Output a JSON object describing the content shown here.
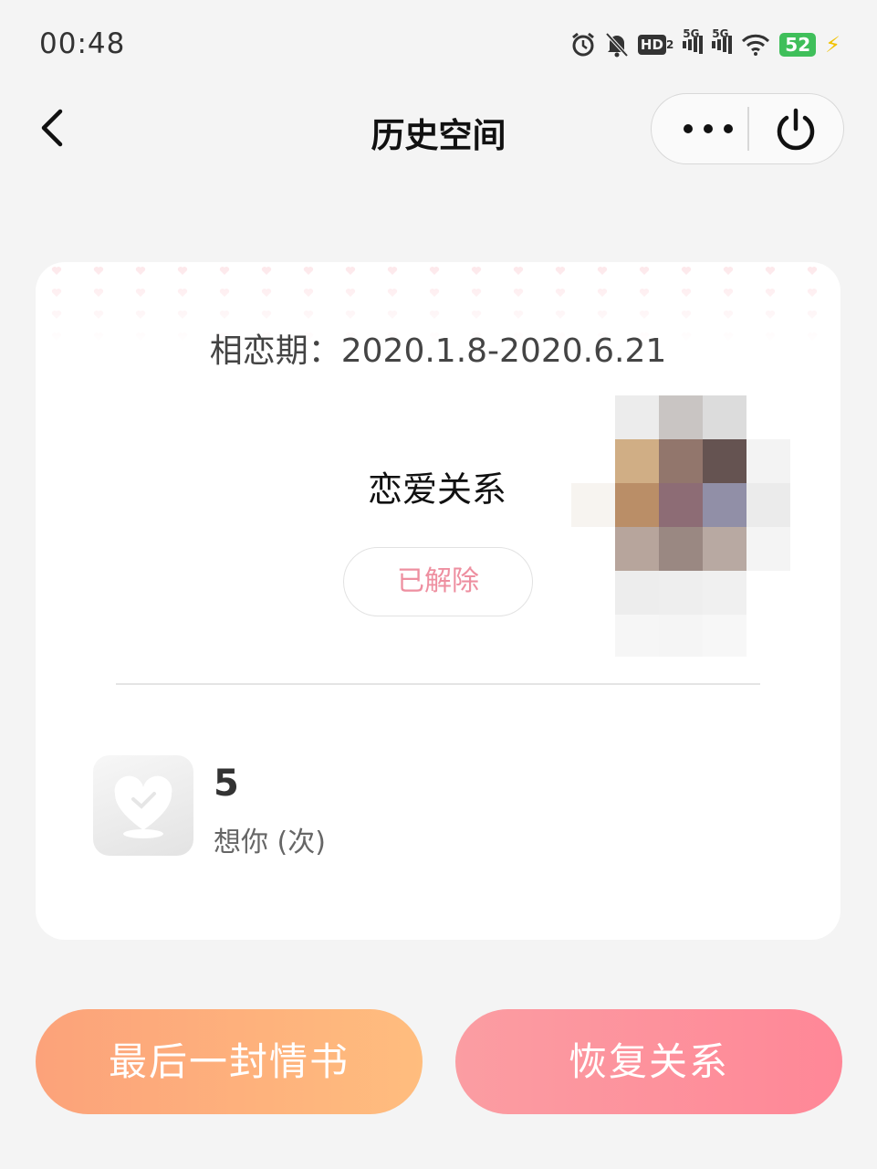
{
  "status_bar": {
    "time": "00:48",
    "icons": [
      "alarm-icon",
      "mute-bell-icon",
      "hd-icon",
      "signal-5g-icon",
      "signal-5g-icon",
      "wifi-icon",
      "battery-icon",
      "charging-icon"
    ],
    "hd_label": "HD",
    "hd_sub": "2",
    "signal_label": "5G",
    "battery_level": "52"
  },
  "nav": {
    "title": "历史空间"
  },
  "card": {
    "period": "相恋期：2020.1.8-2020.6.21",
    "relation_title": "恋爱关系",
    "status": "已解除",
    "stat": {
      "value": "5",
      "label": "想你 (次)"
    }
  },
  "actions": {
    "last_letter": "最后一封情书",
    "restore": "恢复关系"
  },
  "colors": {
    "accent_pink": "#ee8fa0",
    "button_orange": "#fdaf7d",
    "button_pink": "#fd8f9b"
  }
}
